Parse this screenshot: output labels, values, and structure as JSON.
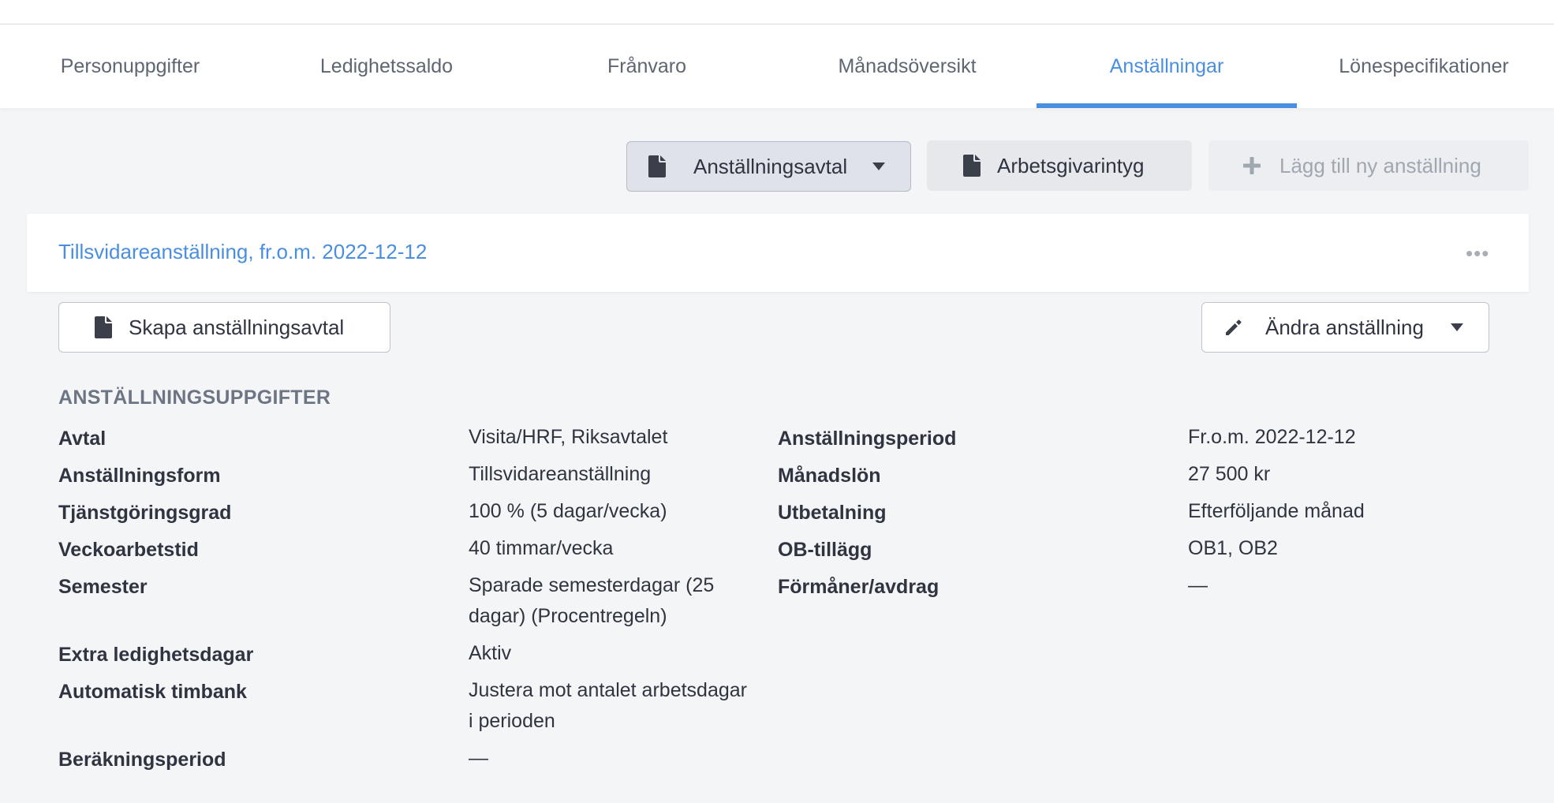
{
  "tabs": [
    {
      "label": "Personuppgifter"
    },
    {
      "label": "Ledighetssaldo"
    },
    {
      "label": "Frånvaro"
    },
    {
      "label": "Månadsöversikt"
    },
    {
      "label": "Anställningar"
    },
    {
      "label": "Lönespecifikationer"
    }
  ],
  "active_tab": "Anställningar",
  "toolbar": {
    "contract_label": "Anställningsavtal",
    "certificate_label": "Arbetsgivarintyg",
    "add_label": "Lägg till ny anställning"
  },
  "employment": {
    "title": "Tillsvidareanställning, fr.o.m. 2022-12-12",
    "create_contract_label": "Skapa anställningsavtal",
    "edit_label": "Ändra anställning",
    "section_title": "ANSTÄLLNINGSUPPGIFTER",
    "left": [
      {
        "label": "Avtal",
        "value": "Visita/HRF, Riksavtalet"
      },
      {
        "label": "Anställningsform",
        "value": "Tillsvidareanställning"
      },
      {
        "label": "Tjänstgöringsgrad",
        "value": "100 % (5 dagar/vecka)"
      },
      {
        "label": "Veckoarbetstid",
        "value": "40 timmar/vecka"
      },
      {
        "label": "Semester",
        "value_line1": "Sparade semesterdagar (25",
        "value_line2": "dagar) (Procentregeln)"
      },
      {
        "label": "Extra ledighetsdagar",
        "value": "Aktiv"
      },
      {
        "label": "Automatisk timbank",
        "value_line1": "Justera mot antalet arbetsdagar",
        "value_line2": "i perioden"
      },
      {
        "label": "Beräkningsperiod",
        "value": "—"
      }
    ],
    "right": [
      {
        "label": "Anställningsperiod",
        "value": "Fr.o.m. 2022-12-12"
      },
      {
        "label": "Månadslön",
        "value": "27 500 kr"
      },
      {
        "label": "Utbetalning",
        "value": "Efterföljande månad"
      },
      {
        "label": "OB-tillägg",
        "value": "OB1, OB2"
      },
      {
        "label": "Förmåner/avdrag",
        "value": "—"
      }
    ]
  },
  "colors": {
    "accent": "#4a8ee0",
    "text": "#2f3440",
    "muted": "#6d7584"
  }
}
